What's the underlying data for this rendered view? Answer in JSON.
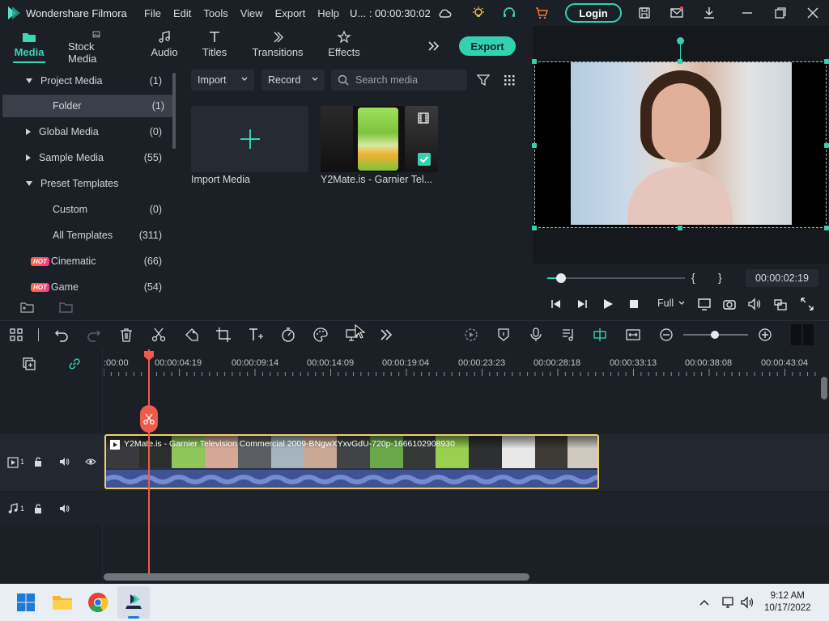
{
  "app": {
    "name": "Wondershare Filmora",
    "timecode": "U... : 00:00:30:02",
    "login_label": "Login"
  },
  "menu": [
    "File",
    "Edit",
    "Tools",
    "View",
    "Export",
    "Help"
  ],
  "tabs": [
    {
      "label": "Media",
      "icon": "folder-icon",
      "active": true
    },
    {
      "label": "Stock Media",
      "icon": "image-icon"
    },
    {
      "label": "Audio",
      "icon": "music-note-icon"
    },
    {
      "label": "Titles",
      "icon": "text-icon"
    },
    {
      "label": "Transitions",
      "icon": "transitions-icon"
    },
    {
      "label": "Effects",
      "icon": "effects-icon"
    }
  ],
  "export_label": "Export",
  "library": [
    {
      "label": "Project Media",
      "count": "(1)",
      "arrow": "down"
    },
    {
      "label": "Folder",
      "count": "(1)",
      "selected": true
    },
    {
      "label": "Global Media",
      "count": "(0)",
      "arrow": "right"
    },
    {
      "label": "Sample Media",
      "count": "(55)",
      "arrow": "right"
    },
    {
      "label": "Preset Templates",
      "count": "",
      "arrow": "down"
    },
    {
      "label": "Custom",
      "count": "(0)"
    },
    {
      "label": "All Templates",
      "count": "(311)"
    },
    {
      "label": "Cinematic",
      "count": "(66)",
      "hot": true
    },
    {
      "label": "Game",
      "count": "(54)",
      "hot": true
    }
  ],
  "hot_label": "HOT",
  "media_toolbar": {
    "import_label": "Import",
    "record_label": "Record",
    "search_placeholder": "Search media"
  },
  "media_items": [
    {
      "label": "Import Media"
    },
    {
      "label": "Y2Mate.is - Garnier  Tel..."
    }
  ],
  "preview": {
    "time": "00:00:02:19",
    "quality": "Full",
    "mark_in": "{",
    "mark_out": "}"
  },
  "ruler": [
    ":00:00",
    "00:00:04:19",
    "00:00:09:14",
    "00:00:14:09",
    "00:00:19:04",
    "00:00:23:23",
    "00:00:28:18",
    "00:00:33:13",
    "00:00:38:08",
    "00:00:43:04"
  ],
  "tracks": {
    "video_index": "1",
    "audio_index": "1"
  },
  "clip": {
    "title": "Y2Mate.is - Garnier  Television Commercial  2009-BNgwXYxvGdU-720p-1666102908930"
  },
  "taskbar": {
    "time": "9:12 AM",
    "date": "10/17/2022"
  },
  "colors": {
    "accent": "#34d1b0",
    "playhead": "#f05a4a",
    "clip_border": "#f0d06a",
    "audio_wave": "#3e5294"
  }
}
